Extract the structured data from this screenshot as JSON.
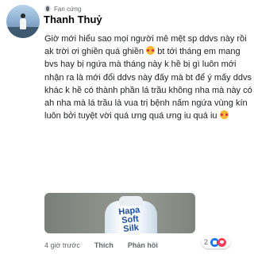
{
  "comment": {
    "badge": "Fan cứng",
    "author": "Thanh Thuỷ",
    "segments": [
      "Giờ mới hiểu sao mọi người mê mệt sp ddvs này rồi ak trời ơi ghiền quá ghiền ",
      " bt tới tháng em mang bvs hay bị ngứa mà tháng này k hề bị gì luôn mới nhận ra là mới đổi ddvs này đấy mà bt để ý mấy ddvs khác k hề có thành phần lá trầu không nha mà này có ah nha mà lá trầu là vua trị bệnh nấm ngứa vùng kín luôn bởi tuyệt vời quá ưng quá ưng iu quá iu "
    ],
    "emoji_icon": "heart-eyes-emoji-icon",
    "photo": {
      "product_brand_line1": "Hapa",
      "product_brand_line2": "Soft",
      "product_brand_line3": "Silk"
    },
    "time": "4 giờ trước",
    "like_label": "Thích",
    "reply_label": "Phản hồi",
    "reaction_count": "2",
    "reaction_icons": [
      "like-icon",
      "heart-icon"
    ],
    "colors": {
      "author": "#050505",
      "meta": "#65676b",
      "like_blue": "#1877f2",
      "heart_red": "#f33e58"
    }
  }
}
